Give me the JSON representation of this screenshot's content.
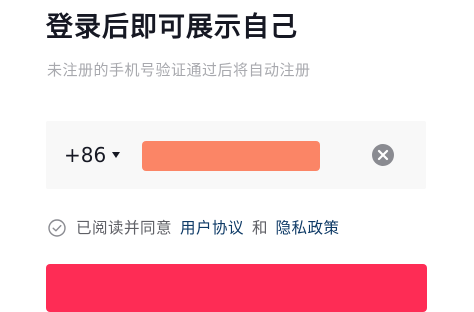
{
  "header": {
    "title": "登录后即可展示自己",
    "subtitle": "未注册的手机号验证通过后将自动注册"
  },
  "phone": {
    "country_code": "+86",
    "caret_icon": "caret-down-icon",
    "input_value": "",
    "input_redacted": true,
    "redaction_color": "#fb8566",
    "clear_icon": "clear-circle-icon"
  },
  "agreement": {
    "check_icon": "check-circle-icon",
    "checked": false,
    "prefix": "已阅读并同意",
    "user_agreement_link": "用户协议",
    "conjunction": "和",
    "privacy_policy_link": "隐私政策",
    "link_color": "#0e3a66"
  },
  "login_button": {
    "color": "#fe2c55"
  }
}
